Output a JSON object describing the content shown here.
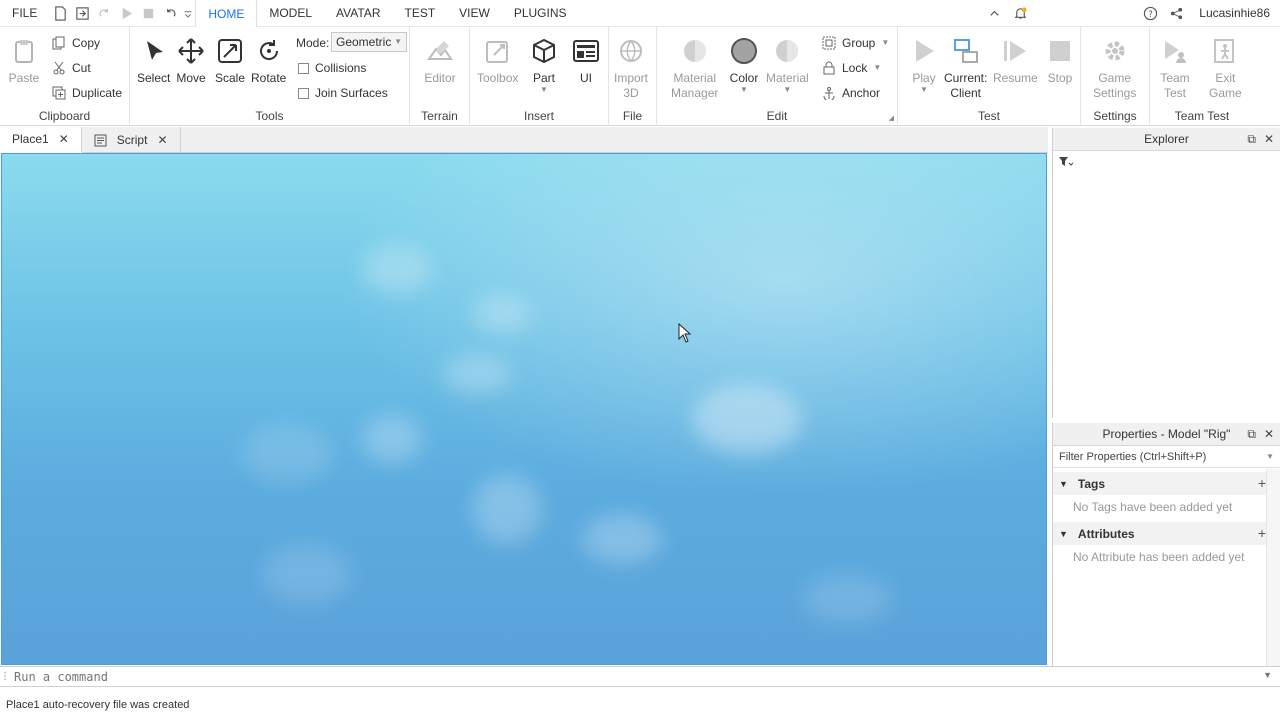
{
  "menu": {
    "file": "FILE",
    "tabs": [
      "HOME",
      "MODEL",
      "AVATAR",
      "TEST",
      "VIEW",
      "PLUGINS"
    ],
    "active_tab": "HOME",
    "user": "Lucasinhie86"
  },
  "ribbon": {
    "clipboard": {
      "label": "Clipboard",
      "paste": "Paste",
      "copy": "Copy",
      "cut": "Cut",
      "duplicate": "Duplicate"
    },
    "tools": {
      "label": "Tools",
      "select": "Select",
      "move": "Move",
      "scale": "Scale",
      "rotate": "Rotate",
      "mode_label": "Mode:",
      "mode_value": "Geometric",
      "collisions": "Collisions",
      "join_surfaces": "Join Surfaces"
    },
    "terrain": {
      "label": "Terrain",
      "editor": "Editor"
    },
    "insert": {
      "label": "Insert",
      "toolbox": "Toolbox",
      "part": "Part",
      "ui": "UI"
    },
    "file": {
      "label": "File",
      "import3d": "Import\n3D"
    },
    "edit": {
      "label": "Edit",
      "material_manager": "Material\nManager",
      "color": "Color",
      "material": "Material",
      "group": "Group",
      "lock": "Lock",
      "anchor": "Anchor"
    },
    "test": {
      "label": "Test",
      "play": "Play",
      "current_client": "Current:\nClient",
      "resume": "Resume",
      "stop": "Stop"
    },
    "settings": {
      "label": "Settings",
      "game_settings": "Game\nSettings"
    },
    "team_test": {
      "label": "Team Test",
      "team_test": "Team\nTest",
      "exit_game": "Exit\nGame"
    }
  },
  "doc_tabs": [
    {
      "label": "Place1"
    },
    {
      "label": "Script"
    }
  ],
  "explorer": {
    "title": "Explorer"
  },
  "properties": {
    "title": "Properties - Model \"Rig\"",
    "filter_placeholder": "Filter Properties (Ctrl+Shift+P)",
    "tags": {
      "title": "Tags",
      "empty": "No Tags have been added yet"
    },
    "attributes": {
      "title": "Attributes",
      "empty": "No Attribute has been added yet"
    }
  },
  "command": {
    "placeholder": "Run a command"
  },
  "status": {
    "message": "Place1 auto-recovery file was created"
  },
  "colors": {
    "accent": "#1a73e8",
    "viewport_sky": "#6cc2e6",
    "viewport_border": "#4d9be0"
  }
}
